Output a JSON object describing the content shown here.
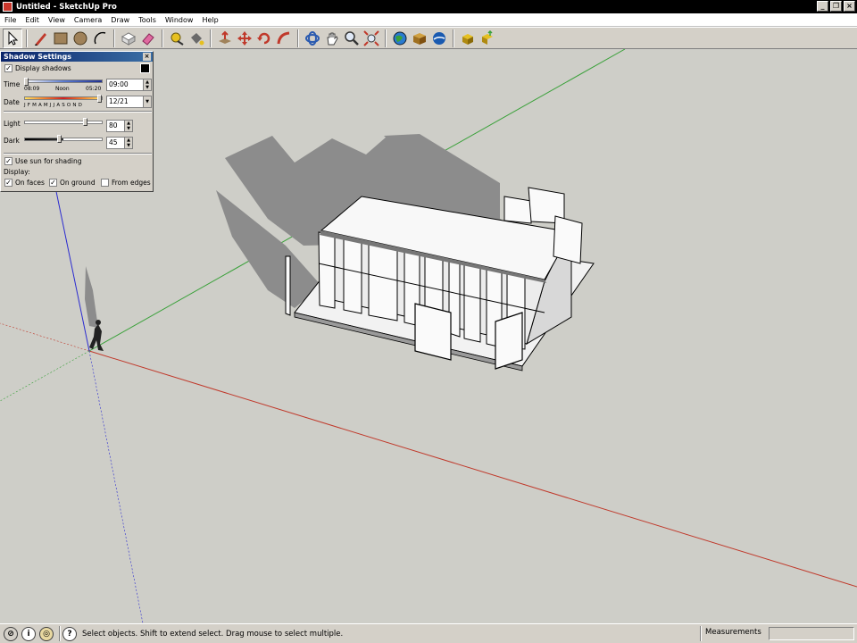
{
  "window": {
    "title": "Untitled - SketchUp Pro",
    "controls": [
      "_",
      "❐",
      "×"
    ]
  },
  "menu": [
    "File",
    "Edit",
    "View",
    "Camera",
    "Draw",
    "Tools",
    "Window",
    "Help"
  ],
  "toolbar": {
    "tools": [
      {
        "name": "select-tool",
        "icon": "arrow-icon",
        "active": true
      },
      {
        "name": "pencil-tool",
        "icon": "pencil-icon"
      },
      {
        "name": "rectangle-tool",
        "icon": "rectangle-icon"
      },
      {
        "name": "circle-tool",
        "icon": "circle-icon"
      },
      {
        "name": "arc-tool",
        "icon": "arc-icon"
      },
      {
        "name": "make-component-tool",
        "icon": "component-icon"
      },
      {
        "name": "eraser-tool",
        "icon": "eraser-icon"
      },
      {
        "name": "tape-measure-tool",
        "icon": "tape-icon"
      },
      {
        "name": "paint-bucket-tool",
        "icon": "paint-bucket-icon"
      },
      {
        "name": "push-pull-tool",
        "icon": "push-pull-icon"
      },
      {
        "name": "move-tool",
        "icon": "move-icon"
      },
      {
        "name": "rotate-tool",
        "icon": "rotate-icon"
      },
      {
        "name": "follow-me-tool",
        "icon": "follow-me-icon"
      },
      {
        "name": "orbit-tool",
        "icon": "orbit-icon"
      },
      {
        "name": "pan-tool",
        "icon": "pan-hand-icon"
      },
      {
        "name": "zoom-tool",
        "icon": "zoom-icon"
      },
      {
        "name": "zoom-extents-tool",
        "icon": "zoom-extents-icon"
      },
      {
        "name": "get-models-tool",
        "icon": "globe-icon"
      },
      {
        "name": "share-model-tool",
        "icon": "share-icon"
      },
      {
        "name": "google-earth-tool",
        "icon": "earth-icon"
      },
      {
        "name": "get-components-tool",
        "icon": "get-component-icon"
      },
      {
        "name": "share-component-tool",
        "icon": "share-component-icon"
      }
    ]
  },
  "shadow_settings": {
    "title": "Shadow Settings",
    "display_shadows_label": "Display shadows",
    "display_shadows_checked": true,
    "time_label": "Time",
    "time_start": "08:09",
    "time_mid": "Noon",
    "time_end": "05:20",
    "time_value": "09:00",
    "date_label": "Date",
    "months": "J F M A M J J A S O N D",
    "date_value": "12/21",
    "light_label": "Light",
    "light_value": "80",
    "light_level": 0.8,
    "dark_label": "Dark",
    "dark_value": "45",
    "dark_level": 0.45,
    "use_sun_label": "Use sun for shading",
    "display_label": "Display:",
    "on_faces_label": "On faces",
    "on_ground_label": "On ground",
    "from_edges_label": "From edges",
    "check_mark": "✓"
  },
  "status": {
    "text": "Select objects. Shift to extend select. Drag mouse to select multiple.",
    "measurements_label": "Measurements",
    "icon_info": "i",
    "icon_help": "?"
  },
  "colors": {
    "viewport": "#cecec8",
    "axis_red": "#c0392b",
    "axis_green": "#3aa13a",
    "axis_blue": "#2a2ad0",
    "shadow": "#8c8c8c"
  }
}
